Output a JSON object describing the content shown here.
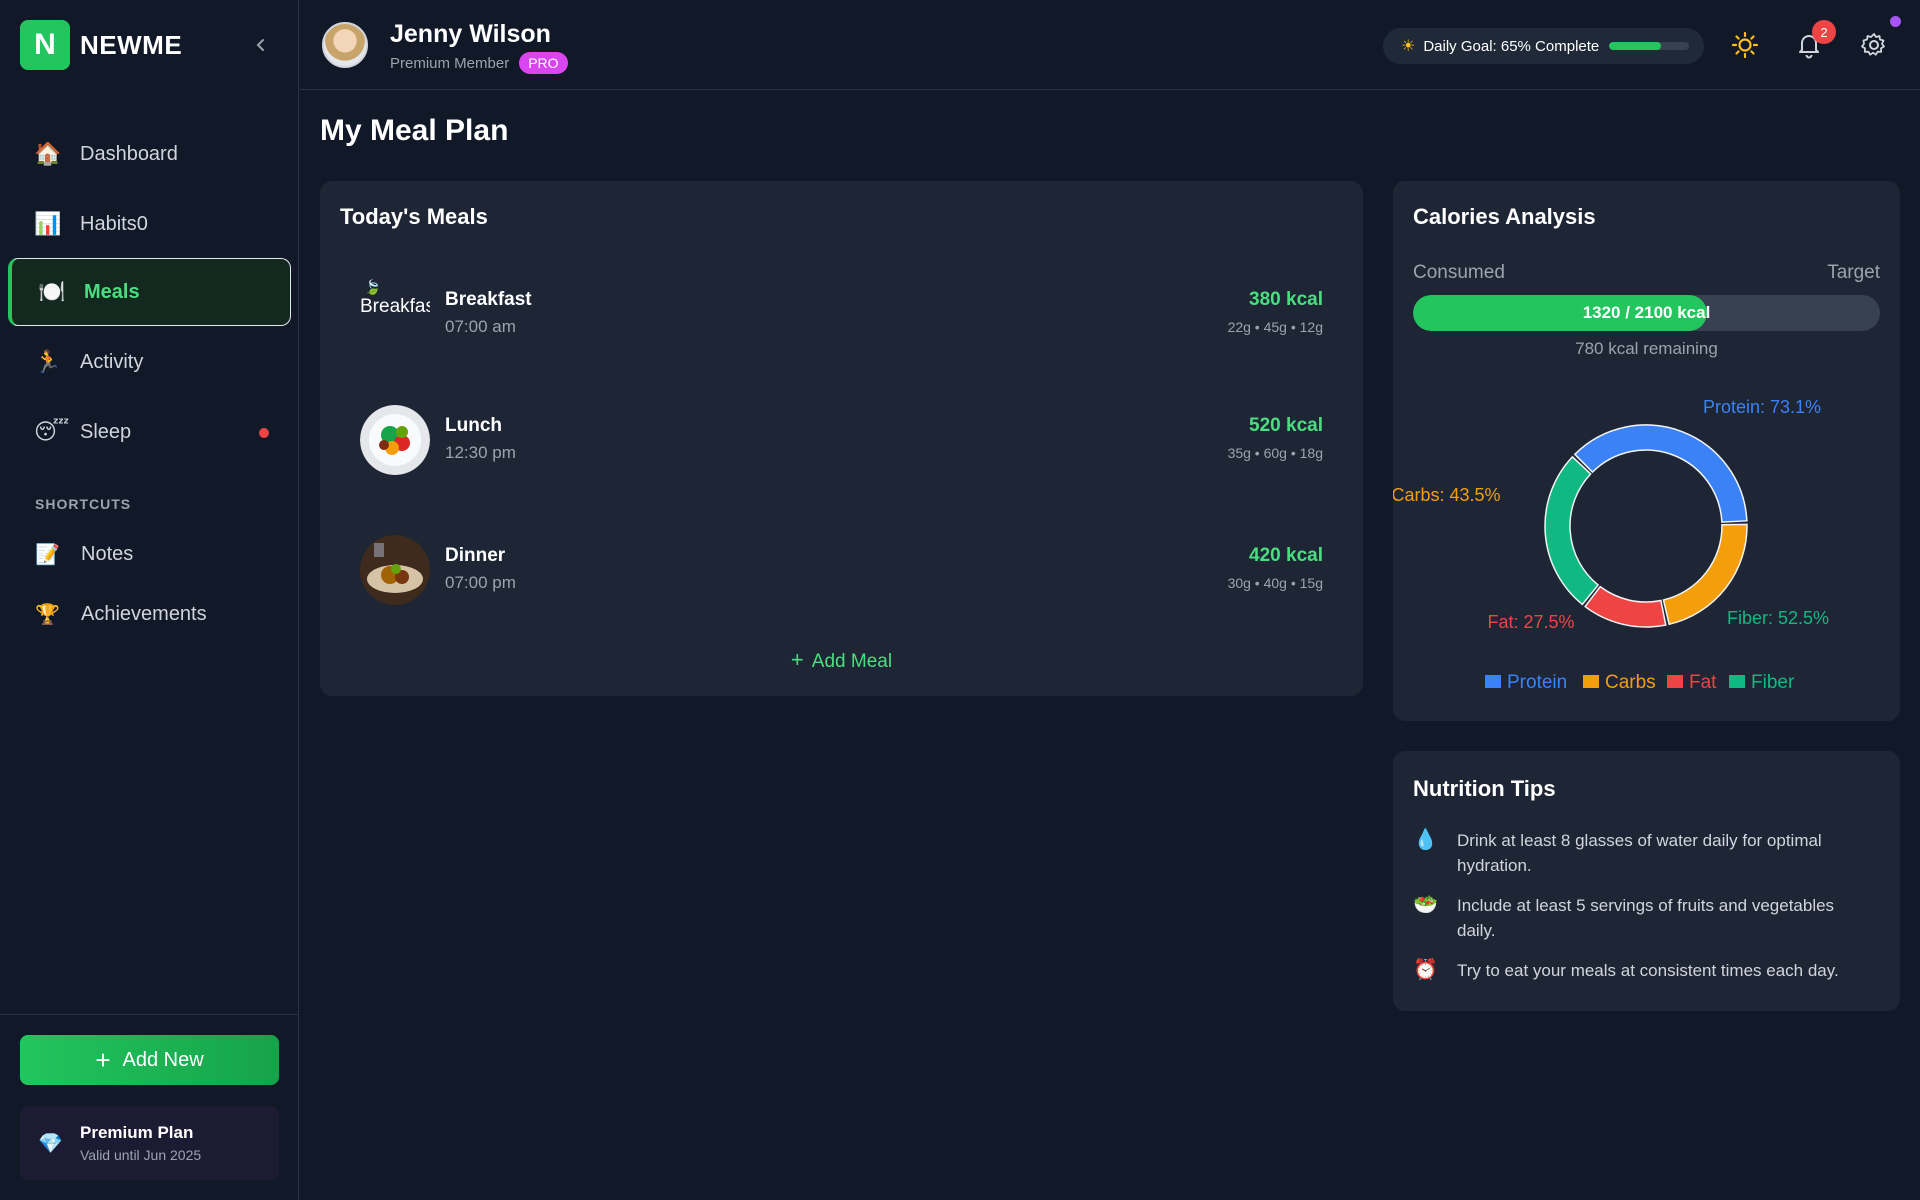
{
  "brand": {
    "logo_letter": "N",
    "name": "NEWME"
  },
  "nav": [
    {
      "icon": "house-icon",
      "emoji": "🏠",
      "label": "Dashboard"
    },
    {
      "icon": "chart-icon",
      "emoji": "📊",
      "label": "Habits0"
    },
    {
      "icon": "plate-icon",
      "emoji": "🍽️",
      "label": "Meals",
      "active": true
    },
    {
      "icon": "runner-icon",
      "emoji": "🏃",
      "label": "Activity"
    },
    {
      "icon": "sleepy-face-icon",
      "emoji": "😴",
      "label": "Sleep",
      "has_alert": true
    }
  ],
  "shortcuts": {
    "title": "SHORTCUTS",
    "items": [
      {
        "icon": "memo-icon",
        "emoji": "📝",
        "label": "Notes"
      },
      {
        "icon": "trophy-icon",
        "emoji": "🏆",
        "label": "Achievements"
      }
    ]
  },
  "sidebar_footer": {
    "add_new_label": "Add New",
    "premium_title": "Premium Plan",
    "premium_subtitle": "Valid until Jun 2025",
    "premium_icon": "💎"
  },
  "header": {
    "user_name": "Jenny Wilson",
    "user_role": "Premium Member",
    "badge": "PRO",
    "daily_goal_text": "Daily Goal: 65% Complete",
    "daily_goal_progress": 0.65,
    "notification_count": "2"
  },
  "page_title": "My Meal Plan",
  "meals": {
    "title": "Today's Meals",
    "items": [
      {
        "name": "Breakfast",
        "time": "07:00 am",
        "kcal": "380 kcal",
        "macros": "22g • 45g • 12g",
        "image_alt": "Breakfast"
      },
      {
        "name": "Lunch",
        "time": "12:30 pm",
        "kcal": "520 kcal",
        "macros": "35g • 60g • 18g"
      },
      {
        "name": "Dinner",
        "time": "07:00 pm",
        "kcal": "420 kcal",
        "macros": "30g • 40g • 15g"
      }
    ],
    "add_label": "Add Meal"
  },
  "calories": {
    "title": "Calories Analysis",
    "consumed_label": "Consumed",
    "target_label": "Target",
    "bar_text": "1320 / 2100 kcal",
    "consumed": 1320,
    "target": 2100,
    "remaining_text": "780 kcal remaining"
  },
  "chart_data": {
    "type": "pie",
    "style": "donut",
    "categories": [
      "Protein",
      "Carbs",
      "Fat",
      "Fiber"
    ],
    "values": [
      73.1,
      43.5,
      27.5,
      52.5
    ],
    "labels": [
      "Protein: 73.1%",
      "Carbs: 43.5%",
      "Fat: 27.5%",
      "Fiber: 52.5%"
    ],
    "colors": [
      "#3b82f6",
      "#f59e0b",
      "#ef4444",
      "#10b981"
    ],
    "legend": "bottom"
  },
  "tips": {
    "title": "Nutrition Tips",
    "items": [
      {
        "icon": "droplet-icon",
        "emoji": "💧",
        "text": "Drink at least 8 glasses of water daily for optimal hydration."
      },
      {
        "icon": "salad-icon",
        "emoji": "🥗",
        "text": "Include at least 5 servings of fruits and vegetables daily."
      },
      {
        "icon": "alarm-clock-icon",
        "emoji": "⏰",
        "text": "Try to eat your meals at consistent times each day."
      }
    ]
  }
}
